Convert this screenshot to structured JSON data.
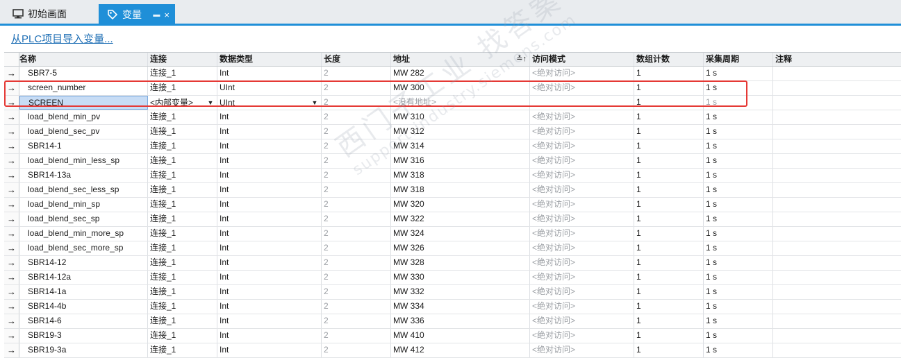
{
  "tabs": [
    {
      "label": "初始画面",
      "icon": "screen-icon",
      "active": false
    },
    {
      "label": "变量",
      "icon": "tag-icon",
      "active": true
    }
  ],
  "import_link": "从PLC项目导入变量...",
  "columns": [
    "名称",
    "连接",
    "数据类型",
    "长度",
    "地址",
    "访问模式",
    "数组计数",
    "采集周期",
    "注释"
  ],
  "rows": [
    {
      "name": "SBR7-5",
      "conn": "连接_1",
      "type": "Int",
      "len": "2",
      "addr": "MW 282",
      "access": "<绝对访问>",
      "count": "1",
      "cycle": "1 s"
    },
    {
      "name": "screen_number",
      "conn": "连接_1",
      "type": "UInt",
      "len": "2",
      "addr": "MW 300",
      "access": "<绝对访问>",
      "count": "1",
      "cycle": "1 s"
    },
    {
      "name": "SCREEN",
      "conn": "<内部变量>",
      "type": "UInt",
      "len": "2",
      "addr": "<没有地址>",
      "access": "",
      "count": "1",
      "cycle": "1 s"
    },
    {
      "name": "load_blend_min_pv",
      "conn": "连接_1",
      "type": "Int",
      "len": "2",
      "addr": "MW 310",
      "access": "<绝对访问>",
      "count": "1",
      "cycle": "1 s"
    },
    {
      "name": "load_blend_sec_pv",
      "conn": "连接_1",
      "type": "Int",
      "len": "2",
      "addr": "MW 312",
      "access": "<绝对访问>",
      "count": "1",
      "cycle": "1 s"
    },
    {
      "name": "SBR14-1",
      "conn": "连接_1",
      "type": "Int",
      "len": "2",
      "addr": "MW 314",
      "access": "<绝对访问>",
      "count": "1",
      "cycle": "1 s"
    },
    {
      "name": "load_blend_min_less_sp",
      "conn": "连接_1",
      "type": "Int",
      "len": "2",
      "addr": "MW 316",
      "access": "<绝对访问>",
      "count": "1",
      "cycle": "1 s"
    },
    {
      "name": "SBR14-13a",
      "conn": "连接_1",
      "type": "Int",
      "len": "2",
      "addr": "MW 318",
      "access": "<绝对访问>",
      "count": "1",
      "cycle": "1 s"
    },
    {
      "name": "load_blend_sec_less_sp",
      "conn": "连接_1",
      "type": "Int",
      "len": "2",
      "addr": "MW 318",
      "access": "<绝对访问>",
      "count": "1",
      "cycle": "1 s"
    },
    {
      "name": "load_blend_min_sp",
      "conn": "连接_1",
      "type": "Int",
      "len": "2",
      "addr": "MW 320",
      "access": "<绝对访问>",
      "count": "1",
      "cycle": "1 s"
    },
    {
      "name": "load_blend_sec_sp",
      "conn": "连接_1",
      "type": "Int",
      "len": "2",
      "addr": "MW 322",
      "access": "<绝对访问>",
      "count": "1",
      "cycle": "1 s"
    },
    {
      "name": "load_blend_min_more_sp",
      "conn": "连接_1",
      "type": "Int",
      "len": "2",
      "addr": "MW 324",
      "access": "<绝对访问>",
      "count": "1",
      "cycle": "1 s"
    },
    {
      "name": "load_blend_sec_more_sp",
      "conn": "连接_1",
      "type": "Int",
      "len": "2",
      "addr": "MW 326",
      "access": "<绝对访问>",
      "count": "1",
      "cycle": "1 s"
    },
    {
      "name": "SBR14-12",
      "conn": "连接_1",
      "type": "Int",
      "len": "2",
      "addr": "MW 328",
      "access": "<绝对访问>",
      "count": "1",
      "cycle": "1 s"
    },
    {
      "name": "SBR14-12a",
      "conn": "连接_1",
      "type": "Int",
      "len": "2",
      "addr": "MW 330",
      "access": "<绝对访问>",
      "count": "1",
      "cycle": "1 s"
    },
    {
      "name": "SBR14-1a",
      "conn": "连接_1",
      "type": "Int",
      "len": "2",
      "addr": "MW 332",
      "access": "<绝对访问>",
      "count": "1",
      "cycle": "1 s"
    },
    {
      "name": "SBR14-4b",
      "conn": "连接_1",
      "type": "Int",
      "len": "2",
      "addr": "MW 334",
      "access": "<绝对访问>",
      "count": "1",
      "cycle": "1 s"
    },
    {
      "name": "SBR14-6",
      "conn": "连接_1",
      "type": "Int",
      "len": "2",
      "addr": "MW 336",
      "access": "<绝对访问>",
      "count": "1",
      "cycle": "1 s"
    },
    {
      "name": "SBR19-3",
      "conn": "连接_1",
      "type": "Int",
      "len": "2",
      "addr": "MW 410",
      "access": "<绝对访问>",
      "count": "1",
      "cycle": "1 s"
    },
    {
      "name": "SBR19-3a",
      "conn": "连接_1",
      "type": "Int",
      "len": "2",
      "addr": "MW 412",
      "access": "<绝对访问>",
      "count": "1",
      "cycle": "1 s"
    }
  ],
  "watermark": {
    "line1": "西门子工业  找答案",
    "line2": "support.industry.siemens.com"
  },
  "colors": {
    "accent": "#1f8fd8",
    "highlight": "#e53935",
    "selection": "#c7dcf5"
  }
}
